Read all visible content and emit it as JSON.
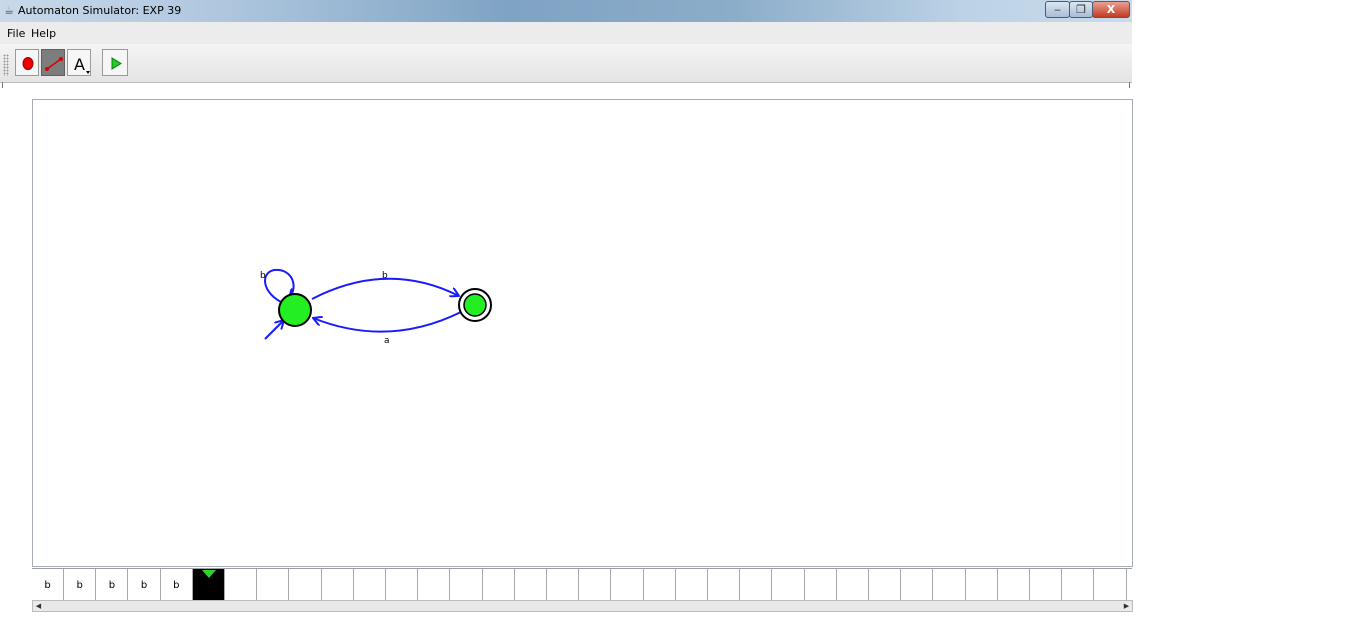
{
  "window": {
    "title": "Automaton Simulator: EXP 39",
    "controls": {
      "minimize": "‒",
      "maximize": "❐",
      "close": "X"
    }
  },
  "menu": {
    "items": [
      "File",
      "Help"
    ]
  },
  "toolbar": {
    "tools": [
      {
        "name": "add-state",
        "icon": "red-circle-icon",
        "selected": false
      },
      {
        "name": "add-transition",
        "icon": "transition-arrow-icon",
        "selected": true
      },
      {
        "name": "label-tool",
        "icon": "letter-a-icon",
        "glyph": "A",
        "selected": false
      },
      {
        "name": "run",
        "icon": "green-play-icon",
        "selected": false
      }
    ]
  },
  "automaton": {
    "states": [
      {
        "id": "q0",
        "initial": true,
        "accepting": false,
        "color": "#22ee22"
      },
      {
        "id": "q1",
        "initial": false,
        "accepting": true,
        "color": "#22ee22"
      }
    ],
    "transitions": [
      {
        "from": "q0",
        "to": "q0",
        "label": "b"
      },
      {
        "from": "q0",
        "to": "q1",
        "label": "b"
      },
      {
        "from": "q1",
        "to": "q0",
        "label": "a"
      }
    ],
    "edge_color": "#1a1aff"
  },
  "tape": {
    "cells": [
      "b",
      "b",
      "b",
      "b",
      "b",
      "",
      "",
      "",
      "",
      "",
      "",
      "",
      "",
      "",
      "",
      "",
      "",
      "",
      "",
      "",
      "",
      "",
      "",
      "",
      "",
      "",
      "",
      "",
      "",
      "",
      "",
      "",
      "",
      "",
      ""
    ],
    "head_index": 5,
    "head_color": "#2fd02f"
  },
  "scrollbar": {
    "left_arrow": "◀",
    "right_arrow": "▶"
  }
}
